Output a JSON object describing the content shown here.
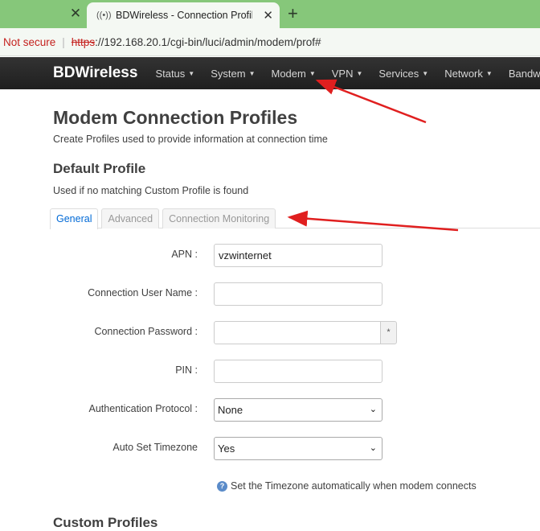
{
  "browser": {
    "tab_title": "BDWireless - Connection Profile",
    "security": "Not secure",
    "url_scheme": "https",
    "url_rest": "://192.168.20.1/cgi-bin/luci/admin/modem/prof#",
    "new_tab": "+",
    "close_glyph": "✕"
  },
  "navbar": {
    "brand": "BDWireless",
    "items": [
      "Status",
      "System",
      "Modem",
      "VPN",
      "Services",
      "Network",
      "Bandw"
    ]
  },
  "page": {
    "title": "Modem Connection Profiles",
    "description": "Create Profiles used to provide information at connection time",
    "default_title": "Default Profile",
    "default_description": "Used if no matching Custom Profile is found",
    "tabs": [
      "General",
      "Advanced",
      "Connection Monitoring"
    ],
    "active_tab": "General",
    "custom_title": "Custom Profiles"
  },
  "form": {
    "apn_label": "APN :",
    "apn_value": "vzwinternet",
    "user_label": "Connection User Name :",
    "user_value": "",
    "password_label": "Connection Password :",
    "password_value": "",
    "reveal_glyph": "*",
    "pin_label": "PIN :",
    "pin_value": "",
    "auth_label": "Authentication Protocol :",
    "auth_value": "None",
    "timezone_label": "Auto Set Timezone",
    "timezone_value": "Yes",
    "timezone_hint": "Set the Timezone automatically when modem connects"
  },
  "icons": {
    "caret": "▼",
    "select_arrow": "⌄",
    "favicon": "((•))",
    "help": "?"
  },
  "colors": {
    "tabstrip": "#86c77a",
    "navbar": "#222222",
    "link": "#0069d6",
    "warning": "#c5221f",
    "annotation": "#e01f1f"
  }
}
